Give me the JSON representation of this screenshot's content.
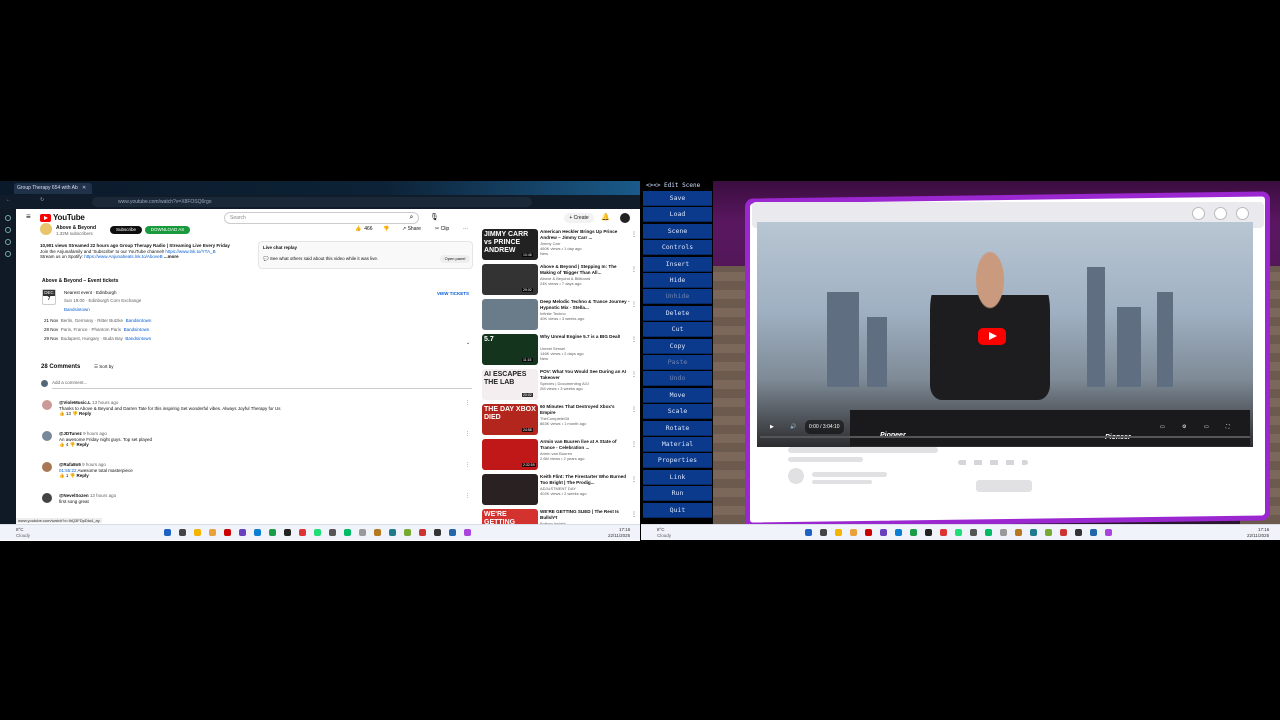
{
  "browser": {
    "tab_title": "Group Therapy 654 with Ab",
    "url": "www.youtube.com/watch?v=X8FOSQ6rgo"
  },
  "youtube": {
    "logo": "YouTube",
    "search_placeholder": "Search",
    "create": "Create",
    "notif_count": "9+",
    "channel": {
      "name": "Above & Beyond",
      "subs": "1.32M subscribers",
      "subscribe": "Subscribe",
      "download": "DOWNLOAD AS"
    },
    "actions": {
      "likes": "466",
      "share": "Share",
      "clip": "Clip"
    },
    "description": {
      "line1": "10,901 views  Streamed 22 hours ago  Group Therapy Radio | Streaming Live Every Friday",
      "line2": "Join the Anjunafamily and 'Subscribe' to our YouTube channel!",
      "link2": "https://www.lnk.to/YTA_B",
      "line3": "Stream us on Spotify:",
      "link3": "https://www.Anjunabeats.lnk.to/AboveB",
      "more": "...more"
    },
    "livechat": {
      "title": "Live chat replay",
      "text": "See what others said about this video while it was live.",
      "open": "Open panel"
    },
    "tickets": {
      "title": "Above & Beyond – Event tickets",
      "view": "VIEW TICKETS",
      "next_label": "Nearest event · Edinburgh",
      "month": "DEC",
      "day": "7",
      "next_sub": "Sun 19:00 · Edinburgh Corn Exchange",
      "next_link": "Bandsintown",
      "events": [
        {
          "date": "21 Nov",
          "place": "Berlin, Germany · Ritter Butzke",
          "link": "Bandsintown"
        },
        {
          "date": "28 Nov",
          "place": "Paris, France · Phantom Paris",
          "link": "Bandsintown"
        },
        {
          "date": "29 Nov",
          "place": "Budapest, Hungary · Buda Bay",
          "link": "Bandsintown"
        }
      ]
    },
    "comments": {
      "count": "28 Comments",
      "sort": "Sort by",
      "add": "Add a comment...",
      "items": [
        {
          "user": "@VioleMusic.L",
          "time": "13 hours ago",
          "text": "Thanks to Above & Beyond and Darren Tate for this inspiring Set",
          "text2": "wonderful vibes. Always Joyful Therapy for Us",
          "likes": "13",
          "reply": "Reply"
        },
        {
          "user": "@JDTunez",
          "time": "9 hours ago",
          "text": "An awesome Friday night guys. Top set  played",
          "likes": "4",
          "reply": "Reply"
        },
        {
          "user": "@Rafa8o5",
          "time": "9 hours ago",
          "ts": "01:55:22",
          "text": "Awesome total masterpiece",
          "likes": "1",
          "reply": "Reply"
        },
        {
          "user": "@NevelSozen",
          "time": "13 hours ago",
          "text": "first song great"
        }
      ]
    },
    "status_url": "www.youtube.com/watch?v=IhQ3FDpDtu4_ay",
    "recs": [
      {
        "thumb": "JIMMY CARR vs PRINCE ANDREW",
        "title": "American Heckler Brings Up Prince Andrew – Jimmy Carr ...",
        "channel": "Jimmy Carr",
        "meta": "460K views • 1 day ago",
        "badge": "New",
        "dur": "10:46",
        "bg": "#222"
      },
      {
        "thumb": "",
        "title": "Above & Beyond | Stepping In: The Making of 'Bigger Than All...",
        "channel": "Above & Beyond & Billboard",
        "meta": "24K views • 7 days ago",
        "badge": "",
        "dur": "29:02",
        "bg": "#333"
      },
      {
        "thumb": "",
        "title": "Deep Melodic Techno & Trance Journey - Hypnotic Mix - Stella...",
        "channel": "Infinite Techno",
        "meta": "40K views • 3 weeks ago",
        "badge": "",
        "dur": "",
        "bg": "#6a7c8a"
      },
      {
        "thumb": "5.7",
        "title": "Why Unreal Engine 5.7 is a BIG Deal!",
        "channel": "Unreal Sensei",
        "meta": "146K views • 2 days ago",
        "badge": "New",
        "dur": "11:15",
        "bg": "#15341e"
      },
      {
        "thumb": "AI ESCAPES THE LAB",
        "title": "POV: What You Would See During an AI Takeover",
        "channel": "Species | Documenting AGI",
        "meta": "2M views • 3 weeks ago",
        "badge": "",
        "dur": "20:02",
        "bg": "#f4eef0"
      },
      {
        "thumb": "THE DAY XBOX DIED",
        "title": "60 Minutes That Destroyed Xbox's Empire",
        "channel": "TheCompleteGit",
        "meta": "863K views • 1 month ago",
        "badge": "",
        "dur": "24:58",
        "bg": "#b3261e"
      },
      {
        "thumb": "",
        "title": "Armin van Buuren live at A State of Trance - Celebration ...",
        "channel": "Armin van Buuren",
        "meta": "2.6M views • 2 years ago",
        "badge": "",
        "dur": "2:32:59",
        "bg": "#c01818"
      },
      {
        "thumb": "",
        "title": "Keith Flint: The Firestarter Who Burned Too Bright | The Prodig...",
        "channel": "ADJUSTMENT DAY",
        "meta": "402K views • 2 weeks ago",
        "badge": "",
        "dur": "",
        "bg": "#2a2222"
      },
      {
        "thumb": "WE'RE GETTING SUED",
        "title": "WE'RE GETTING SUED | The Rest Is Bullsh*t",
        "channel": "Bottom Insight",
        "meta": "",
        "badge": "",
        "dur": "",
        "bg": "#d4322e"
      }
    ]
  },
  "taskbar_left": {
    "weather": "8°C",
    "cond": "Cloudy",
    "time": "17:16",
    "date": "22/11/2025"
  },
  "taskbar_right": {
    "weather": "8°C",
    "cond": "Cloudy",
    "time": "17:16",
    "date": "22/11/2025"
  },
  "editor": {
    "title": "<><> Edit Scene",
    "buttons": [
      "Save",
      "Load",
      "Scene",
      "Controls",
      "Insert",
      "Hide",
      "Unhide",
      "Delete",
      "Cut",
      "Copy",
      "Paste",
      "Undo",
      "Move",
      "Scale",
      "Rotate",
      "Material",
      "Properties",
      "Link",
      "Run",
      "Quit"
    ],
    "disabled": [
      "Unhide",
      "Paste",
      "Undo"
    ]
  },
  "player": {
    "time": "0:00 / 3:04:10",
    "brand": "Pioneer"
  }
}
